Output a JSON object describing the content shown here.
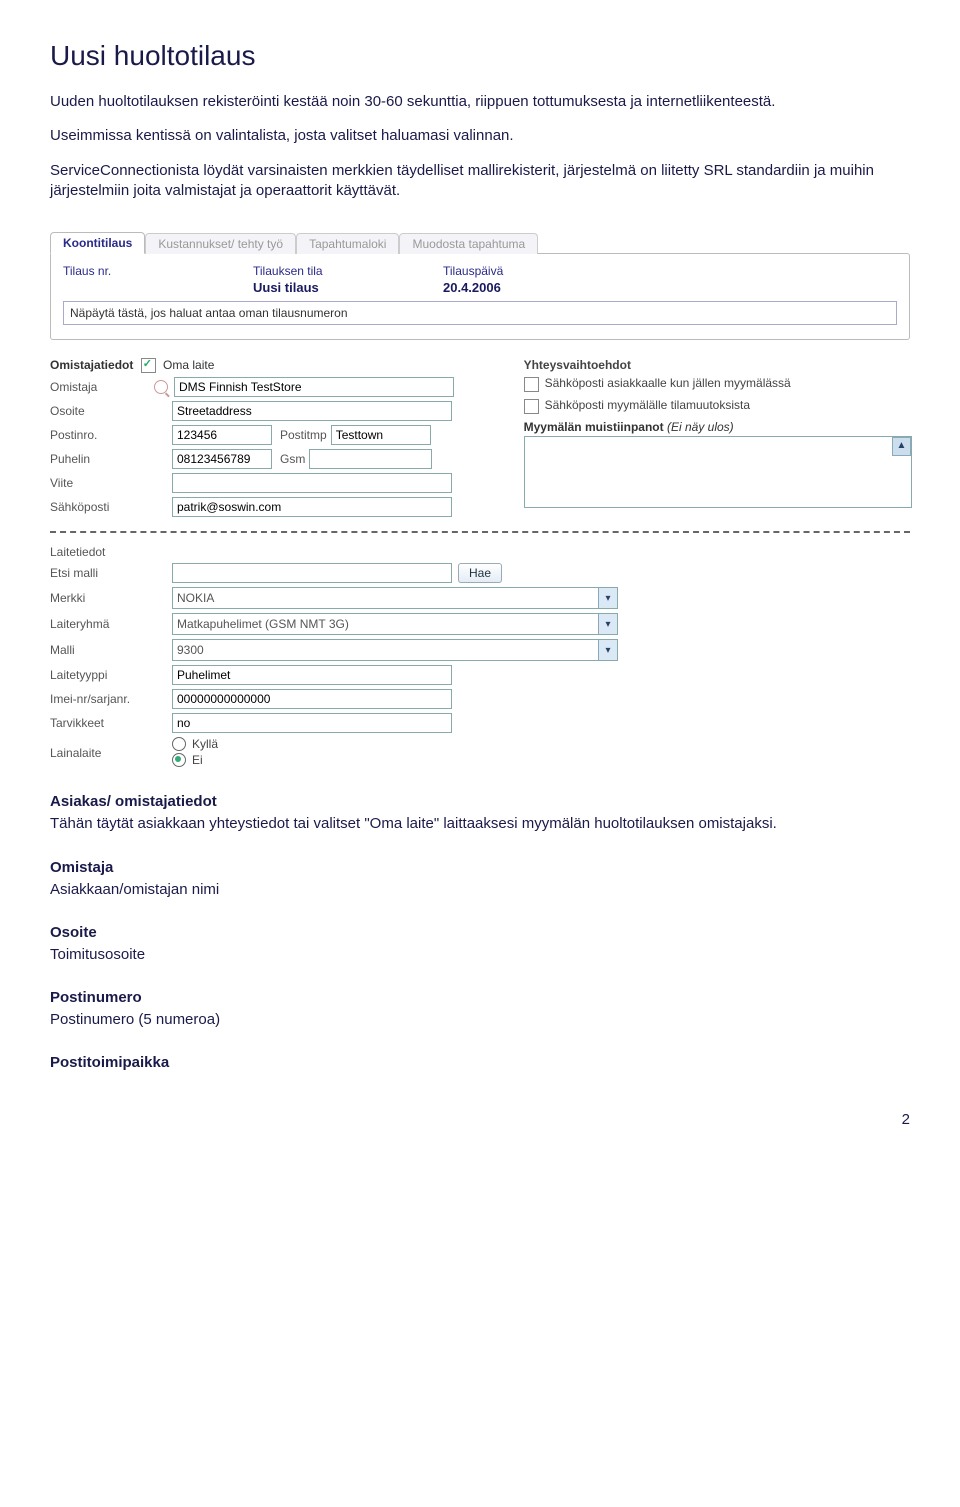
{
  "title": "Uusi huoltotilaus",
  "intro": [
    "Uuden huoltotilauksen rekisteröinti kestää noin 30-60 sekunttia, riippuen tottumuksesta ja internetliikenteestä.",
    "Useimmissa kentissä on valintalista, josta valitset haluamasi valinnan.",
    "ServiceConnectionista löydät varsinaisten merkkien täydelliset mallirekisterit, järjestelmä on liitetty SRL standardiin ja muihin järjestelmiin joita valmistajat ja operaattorit käyttävät."
  ],
  "tabs": [
    "Koontitilaus",
    "Kustannukset/ tehty työ",
    "Tapahtumaloki",
    "Muodosta tapahtuma"
  ],
  "order": {
    "col1_label": "Tilaus nr.",
    "col2_label": "Tilauksen tila",
    "col2_value": "Uusi tilaus",
    "col3_label": "Tilauspäivä",
    "col3_value": "20.4.2006",
    "hint": "Näpäytä tästä, jos haluat antaa oman tilausnumeron"
  },
  "owner": {
    "section": "Omistajatiedot",
    "own_device": "Oma laite",
    "labels": {
      "owner": "Omistaja",
      "address": "Osoite",
      "zip": "Postinro.",
      "city": "Postitmp",
      "phone": "Puhelin",
      "gsm": "Gsm",
      "ref": "Viite",
      "email": "Sähköposti"
    },
    "values": {
      "owner": "DMS Finnish TestStore",
      "address": "Streetaddress",
      "zip": "123456",
      "city": "Testtown",
      "phone": "08123456789",
      "gsm": "",
      "ref": "",
      "email": "patrik@soswin.com"
    }
  },
  "contact": {
    "section": "Yhteysvaihtoehdot",
    "opt1": "Sähköposti asiakkaalle kun jällen myymälässä",
    "opt2": "Sähköposti myymälälle tilamuutoksista",
    "notes_label": "Myymälän muistiinpanot",
    "notes_hint": "(Ei näy ulos)"
  },
  "device": {
    "section": "Laitetiedot",
    "labels": {
      "find": "Etsi malli",
      "search_btn": "Hae",
      "brand": "Merkki",
      "group": "Laiteryhmä",
      "model": "Malli",
      "type": "Laitetyyppi",
      "imei": "Imei-nr/sarjanr.",
      "acc": "Tarvikkeet",
      "loan": "Lainalaite",
      "yes": "Kyllä",
      "no": "Ei"
    },
    "values": {
      "brand": "NOKIA",
      "group": "Matkapuhelimet (GSM NMT 3G)",
      "model": "9300",
      "type": "Puhelimet",
      "imei": "00000000000000",
      "acc": "no"
    }
  },
  "sections": {
    "s1": "Asiakas/ omistajatiedot",
    "s1_text": "Tähän täytät asiakkaan yhteystiedot tai valitset \"Oma laite\" laittaaksesi myymälän huoltotilauksen omistajaksi.",
    "s2": "Omistaja",
    "s2_text": "Asiakkaan/omistajan nimi",
    "s3": "Osoite",
    "s3_text": "Toimitusosoite",
    "s4": "Postinumero",
    "s4_text": "Postinumero (5 numeroa)",
    "s5": "Postitoimipaikka"
  },
  "page": "2"
}
